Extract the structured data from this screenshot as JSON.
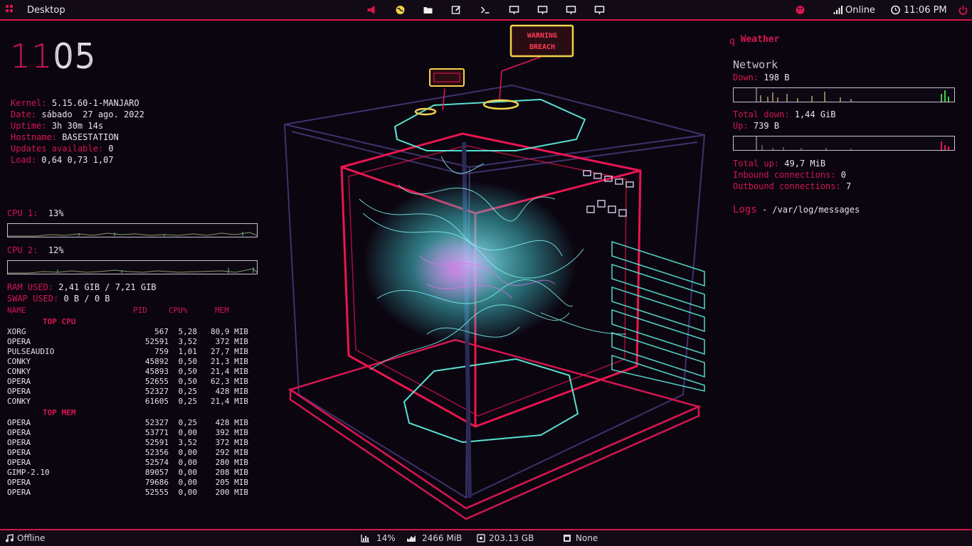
{
  "topbar": {
    "workspace_label": "Desktop",
    "network_status": "Online",
    "time": "11:06 PM",
    "launchers": [
      "megaphone-icon",
      "globe-icon",
      "folder-icon",
      "edit-icon",
      "terminal-icon",
      "monitor-icon",
      "monitor-icon",
      "monitor-icon",
      "monitor-icon"
    ],
    "accent": "#d4164f"
  },
  "clock": {
    "hours": "11",
    "minutes": "05"
  },
  "system": {
    "kernel_label": "Kernel:",
    "kernel": "5.15.60-1-MANJARO",
    "date_label": "Date:",
    "date": "sábado  27 ago. 2022",
    "uptime_label": "Uptime:",
    "uptime": "3h 30m 14s",
    "hostname_label": "Hostname:",
    "hostname": "BASESTATION",
    "updates_label": "Updates available:",
    "updates": "0",
    "load_label": "Load:",
    "load": "0,64 0,73 1,07"
  },
  "cpu": {
    "cpu1_label": "CPU 1:",
    "cpu1": "13%",
    "cpu2_label": "CPU 2:",
    "cpu2": "12%",
    "ram_label": "RAM USED:",
    "ram": "2,41 GIB / 7,21 GIB",
    "swap_label": "SWAP USED:",
    "swap": "0 B / 0 B"
  },
  "process_table": {
    "headers": {
      "name": "NAME",
      "pid": "PID",
      "cpu": "CPU%",
      "mem": "MEM"
    },
    "top_cpu_title": "TOP CPU",
    "top_cpu": [
      {
        "name": "XORG",
        "pid": "567",
        "cpu": "5,28",
        "mem": "80,9 MIB"
      },
      {
        "name": "OPERA",
        "pid": "52591",
        "cpu": "3,52",
        "mem": "372 MIB"
      },
      {
        "name": "PULSEAUDIO",
        "pid": "759",
        "cpu": "1,01",
        "mem": "27,7 MIB"
      },
      {
        "name": "CONKY",
        "pid": "45892",
        "cpu": "0,50",
        "mem": "21,3 MIB"
      },
      {
        "name": "CONKY",
        "pid": "45893",
        "cpu": "0,50",
        "mem": "21,4 MIB"
      },
      {
        "name": "OPERA",
        "pid": "52655",
        "cpu": "0,50",
        "mem": "62,3 MIB"
      },
      {
        "name": "OPERA",
        "pid": "52327",
        "cpu": "0,25",
        "mem": "428 MIB"
      },
      {
        "name": "CONKY",
        "pid": "61605",
        "cpu": "0,25",
        "mem": "21,4 MIB"
      }
    ],
    "top_mem_title": "TOP MEM",
    "top_mem": [
      {
        "name": "OPERA",
        "pid": "52327",
        "cpu": "0,25",
        "mem": "428 MIB"
      },
      {
        "name": "OPERA",
        "pid": "53771",
        "cpu": "0,00",
        "mem": "392 MIB"
      },
      {
        "name": "OPERA",
        "pid": "52591",
        "cpu": "3,52",
        "mem": "372 MIB"
      },
      {
        "name": "OPERA",
        "pid": "52356",
        "cpu": "0,00",
        "mem": "292 MIB"
      },
      {
        "name": "OPERA",
        "pid": "52574",
        "cpu": "0,00",
        "mem": "280 MIB"
      },
      {
        "name": "GIMP-2.10",
        "pid": "89057",
        "cpu": "0,00",
        "mem": "208 MIB"
      },
      {
        "name": "OPERA",
        "pid": "79686",
        "cpu": "0,00",
        "mem": "205 MIB"
      },
      {
        "name": "OPERA",
        "pid": "52555",
        "cpu": "0,00",
        "mem": "200 MIB"
      }
    ]
  },
  "weather": {
    "icon": "q",
    "label": "Weather"
  },
  "network": {
    "title": "Network",
    "down_label": "Down:",
    "down": "198 B",
    "total_down_label": "Total down:",
    "total_down": "1,44 GiB",
    "up_label": "Up:",
    "up": "739 B",
    "total_up_label": "Total up:",
    "total_up": "49,7 MiB",
    "inbound_label": "Inbound connections:",
    "inbound": "0",
    "outbound_label": "Outbound connections:",
    "outbound": "7"
  },
  "logs": {
    "title": "Logs",
    "path": " - /var/log/messages"
  },
  "wallpaper": {
    "sign_big": "WARNING BREACH"
  },
  "bottombar": {
    "music": "Offline",
    "cpu": "14%",
    "memory": "2466 MiB",
    "disk": "203.13 GB",
    "window": "None"
  }
}
